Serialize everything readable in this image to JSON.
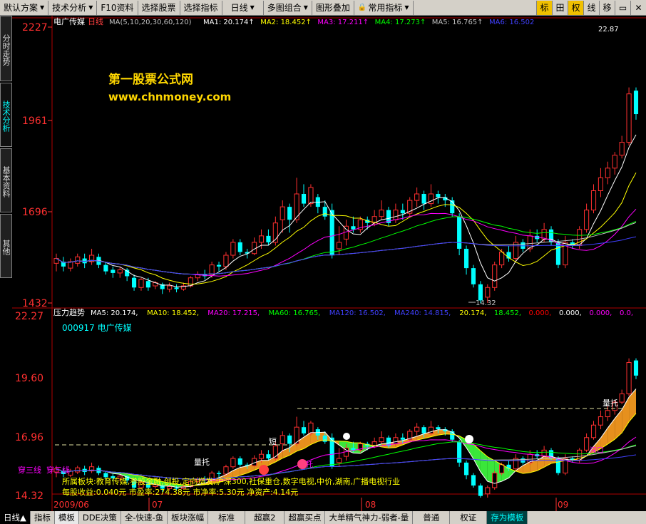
{
  "menu": {
    "items": [
      {
        "label": "默认方案"
      },
      {
        "label": "技术分析"
      },
      {
        "label": "F10资料"
      },
      {
        "label": "选择股票"
      },
      {
        "label": "选择指标"
      },
      {
        "label": "日线"
      },
      {
        "label": "多图组合"
      },
      {
        "label": "图形叠加"
      },
      {
        "label": "常用指标"
      }
    ],
    "tools": [
      "标",
      "田",
      "权",
      "线",
      "移"
    ]
  },
  "side_tabs": [
    "分时走势",
    "技术分析",
    "基本资料",
    "其他"
  ],
  "upper": {
    "stock_name": "电广传媒",
    "period": "日线",
    "ma_params": "MA(5,10,20,30,60,120)",
    "ma_values": [
      {
        "label": "MA1: 20.174",
        "color": "#ffffff"
      },
      {
        "label": "MA2: 18.452",
        "color": "#ffff00"
      },
      {
        "label": "MA3: 17.211",
        "color": "#ff00ff"
      },
      {
        "label": "MA4: 17.273",
        "color": "#00ff00"
      },
      {
        "label": "MA5: 16.765",
        "color": "#c0c0c0"
      },
      {
        "label": "MA6: 16.502",
        "color": "#4040ff"
      }
    ],
    "y_ticks": [
      "2227",
      "1961",
      "1696",
      "1432"
    ],
    "watermark_title": "第一股票公式网",
    "watermark_url": "www.chnmoney.com",
    "high_label": "22.87",
    "low_label": "14.32"
  },
  "lower": {
    "indicator_name": "压力趋势",
    "values": [
      {
        "label": "MA5: 20.174",
        "color": "#ffffff"
      },
      {
        "label": "MA10: 18.452",
        "color": "#ffff00"
      },
      {
        "label": "MA20: 17.215",
        "color": "#ff00ff"
      },
      {
        "label": "MA60: 16.765",
        "color": "#00ff00"
      },
      {
        "label": "MA120: 16.502",
        "color": "#4040ff"
      },
      {
        "label": "MA240: 14.815",
        "color": "#4040ff"
      },
      {
        "label": "20.174",
        "color": "#ffff00"
      },
      {
        "label": "18.452",
        "color": "#00ff00"
      },
      {
        "label": "0.000",
        "color": "#ff0000"
      },
      {
        "label": "0.000",
        "color": "#ffffff"
      },
      {
        "label": "0.000",
        "color": "#ff00ff"
      },
      {
        "label": "0.0",
        "color": "#ff00ff"
      }
    ],
    "code_label": "000917 电广传媒",
    "y_ticks": [
      "22.27",
      "19.60",
      "16.96",
      "14.32"
    ],
    "annotations": {
      "chuan_san_xian": "穿三线",
      "duan": "短",
      "liang_tuo": "量托",
      "tuo": "托",
      "shen_kou": "深口"
    },
    "info_lines": [
      "所属板块:教育传媒,参股金融,创投,定向增发,沪深300,社保重仓,数字电视,中价,湖南,广播电视行业",
      "每股收益:0.040元  市盈率:274.38元  市净率:5.30元  净资产:4.14元"
    ],
    "time_axis": [
      "2009/06",
      "07",
      "08",
      "09"
    ]
  },
  "bottom_tabs": [
    {
      "label": "日线▲"
    },
    {
      "label": "指标"
    },
    {
      "label": "模板"
    },
    {
      "label": "DDE决策"
    },
    {
      "label": "全-快速-鱼"
    },
    {
      "label": "板块涨幅"
    },
    {
      "label": "标准"
    },
    {
      "label": "超赢2"
    },
    {
      "label": "超赢买点"
    },
    {
      "label": "大单精气神力-弱者-量"
    },
    {
      "label": "普通"
    },
    {
      "label": "权证"
    },
    {
      "label": "存为模板"
    }
  ],
  "chart_data": {
    "type": "candlestick",
    "title": "电广传媒 日线",
    "ylim": [
      14.32,
      22.87
    ],
    "candles": [
      [
        15.55,
        15.7,
        15.3,
        15.85
      ],
      [
        15.6,
        15.45,
        15.3,
        15.75
      ],
      [
        15.4,
        15.6,
        15.3,
        15.7
      ],
      [
        15.55,
        15.75,
        15.45,
        15.85
      ],
      [
        15.7,
        15.55,
        15.4,
        15.85
      ],
      [
        15.6,
        15.8,
        15.5,
        16.0
      ],
      [
        15.75,
        15.5,
        15.4,
        15.85
      ],
      [
        15.5,
        15.3,
        15.2,
        15.6
      ],
      [
        15.35,
        15.25,
        15.1,
        15.45
      ],
      [
        15.25,
        15.35,
        15.1,
        15.45
      ],
      [
        15.35,
        15.15,
        15.0,
        15.4
      ],
      [
        15.1,
        14.8,
        14.7,
        15.2
      ],
      [
        14.8,
        15.05,
        14.7,
        15.1
      ],
      [
        15.0,
        14.8,
        14.7,
        15.1
      ],
      [
        14.85,
        14.95,
        14.75,
        15.0
      ],
      [
        14.9,
        14.75,
        14.6,
        14.95
      ],
      [
        14.75,
        14.85,
        14.65,
        14.95
      ],
      [
        14.8,
        14.75,
        14.65,
        14.9
      ],
      [
        14.75,
        14.85,
        14.7,
        14.95
      ],
      [
        14.85,
        15.1,
        14.8,
        15.15
      ],
      [
        15.1,
        15.2,
        15.0,
        15.3
      ],
      [
        15.2,
        15.15,
        15.05,
        15.35
      ],
      [
        15.2,
        15.5,
        15.1,
        15.6
      ],
      [
        15.5,
        15.45,
        15.3,
        15.6
      ],
      [
        15.45,
        15.8,
        15.35,
        15.9
      ],
      [
        15.8,
        16.2,
        15.7,
        16.3
      ],
      [
        16.2,
        15.9,
        15.8,
        16.3
      ],
      [
        15.9,
        15.85,
        15.7,
        16.0
      ],
      [
        15.85,
        16.2,
        15.8,
        16.35
      ],
      [
        16.2,
        16.4,
        16.0,
        16.6
      ],
      [
        16.4,
        16.2,
        16.1,
        16.6
      ],
      [
        16.2,
        16.8,
        16.1,
        17.0
      ],
      [
        16.9,
        17.3,
        16.5,
        17.5
      ],
      [
        17.3,
        16.9,
        16.5,
        17.4
      ],
      [
        16.9,
        17.7,
        16.8,
        18.2
      ],
      [
        17.7,
        17.4,
        17.3,
        18.0
      ],
      [
        17.4,
        17.9,
        17.3,
        18.0
      ],
      [
        17.6,
        17.3,
        17.1,
        17.7
      ],
      [
        17.3,
        17.0,
        16.9,
        17.5
      ],
      [
        17.2,
        15.8,
        15.7,
        17.4
      ],
      [
        16.0,
        16.2,
        15.8,
        16.7
      ],
      [
        16.3,
        16.7,
        16.1,
        16.9
      ],
      [
        16.7,
        16.6,
        16.5,
        17.0
      ],
      [
        16.6,
        16.9,
        16.5,
        17.0
      ],
      [
        16.9,
        16.8,
        16.6,
        17.0
      ],
      [
        16.8,
        17.0,
        16.7,
        17.2
      ],
      [
        17.0,
        17.2,
        16.9,
        17.5
      ],
      [
        17.2,
        16.8,
        16.7,
        17.3
      ],
      [
        16.9,
        17.2,
        16.8,
        17.4
      ],
      [
        17.2,
        17.1,
        16.9,
        17.4
      ],
      [
        17.1,
        17.5,
        17.0,
        17.6
      ],
      [
        17.5,
        17.7,
        17.3,
        17.9
      ],
      [
        17.7,
        17.4,
        17.2,
        17.8
      ],
      [
        17.4,
        17.7,
        17.3,
        18.0
      ],
      [
        17.7,
        17.6,
        17.4,
        17.8
      ],
      [
        17.6,
        17.5,
        17.3,
        17.7
      ],
      [
        17.5,
        17.1,
        17.0,
        17.6
      ],
      [
        17.0,
        16.0,
        15.8,
        17.1
      ],
      [
        16.0,
        15.4,
        15.2,
        16.1
      ],
      [
        15.4,
        14.9,
        14.8,
        15.5
      ],
      [
        14.9,
        14.4,
        14.32,
        15.0
      ],
      [
        14.5,
        14.8,
        14.32,
        14.9
      ],
      [
        14.8,
        15.5,
        14.7,
        15.6
      ],
      [
        15.5,
        15.9,
        15.4,
        16.0
      ],
      [
        15.9,
        15.7,
        15.6,
        16.1
      ],
      [
        15.7,
        16.2,
        15.6,
        16.4
      ],
      [
        16.2,
        16.0,
        15.9,
        16.3
      ],
      [
        16.0,
        16.4,
        15.9,
        16.6
      ],
      [
        16.4,
        16.3,
        16.2,
        16.6
      ],
      [
        16.3,
        16.6,
        16.2,
        16.8
      ],
      [
        16.6,
        16.2,
        16.1,
        16.7
      ],
      [
        16.2,
        15.5,
        15.4,
        16.3
      ],
      [
        15.5,
        16.2,
        15.4,
        16.4
      ],
      [
        16.2,
        16.1,
        16.0,
        16.3
      ],
      [
        16.1,
        16.6,
        16.0,
        16.7
      ],
      [
        16.6,
        17.2,
        16.5,
        17.4
      ],
      [
        17.2,
        17.8,
        17.1,
        18.0
      ],
      [
        17.8,
        18.2,
        17.6,
        18.5
      ],
      [
        18.2,
        18.5,
        18.0,
        18.7
      ],
      [
        18.5,
        18.9,
        18.3,
        19.0
      ],
      [
        18.9,
        19.3,
        18.8,
        19.5
      ],
      [
        19.3,
        20.8,
        19.2,
        21.0
      ],
      [
        20.9,
        20.174,
        20.0,
        21.0
      ]
    ],
    "ma_series": [
      {
        "name": "MA1",
        "color": "#ffffff"
      },
      {
        "name": "MA2",
        "color": "#ffff00"
      },
      {
        "name": "MA3",
        "color": "#ff00ff"
      },
      {
        "name": "MA4",
        "color": "#00ff00"
      },
      {
        "name": "MA5",
        "color": "#c0c0c0"
      },
      {
        "name": "MA6",
        "color": "#4040ff"
      }
    ]
  }
}
